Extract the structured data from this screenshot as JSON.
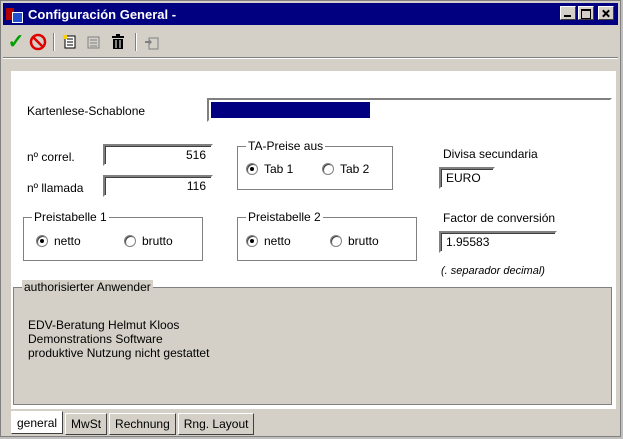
{
  "window": {
    "title": "Configuración General -",
    "controls": [
      "minimize",
      "maximize",
      "close"
    ]
  },
  "toolbar": {
    "buttons": [
      {
        "name": "accept",
        "icon": "checkmark-icon"
      },
      {
        "name": "cancel",
        "icon": "no-entry-icon"
      },
      {
        "name": "new",
        "icon": "new-record-icon"
      },
      {
        "name": "edit",
        "icon": "edit-record-icon"
      },
      {
        "name": "delete",
        "icon": "trash-icon"
      },
      {
        "name": "copy",
        "icon": "copy-record-icon"
      }
    ]
  },
  "form": {
    "template_label": "Kartenlese-Schablone",
    "template_progress": 0.4,
    "correl_label": "nº correl.",
    "correl_value": "516",
    "llamada_label": "nº llamada",
    "llamada_value": "116",
    "ta_group": {
      "legend": "TA-Preise aus",
      "options": [
        "Tab 1",
        "Tab 2"
      ],
      "selected": "Tab 1"
    },
    "preistabelle1": {
      "legend": "Preistabelle 1",
      "options": [
        "netto",
        "brutto"
      ],
      "selected": "netto"
    },
    "preistabelle2": {
      "legend": "Preistabelle 2",
      "options": [
        "netto",
        "brutto"
      ],
      "selected": "netto"
    },
    "divisa_label": "Divisa secundaria",
    "divisa_value": "EURO",
    "factor_label": "Factor de conversión",
    "factor_value": "1.95583",
    "separator_hint": "(. separador decimal)"
  },
  "authorized": {
    "legend": "authorisierter Anwender",
    "lines": [
      "EDV-Beratung Helmut Kloos",
      "Demonstrations Software",
      "produktive Nutzung nicht gestattet"
    ]
  },
  "tabs": [
    {
      "label": "general",
      "active": true
    },
    {
      "label": "MwSt",
      "active": false
    },
    {
      "label": "Rechnung",
      "active": false
    },
    {
      "label": "Rng. Layout",
      "active": false
    }
  ],
  "colors": {
    "titlebar": "#000080",
    "progress_fill": "#000080",
    "accept": "#00a000",
    "cancel": "#e00000"
  }
}
